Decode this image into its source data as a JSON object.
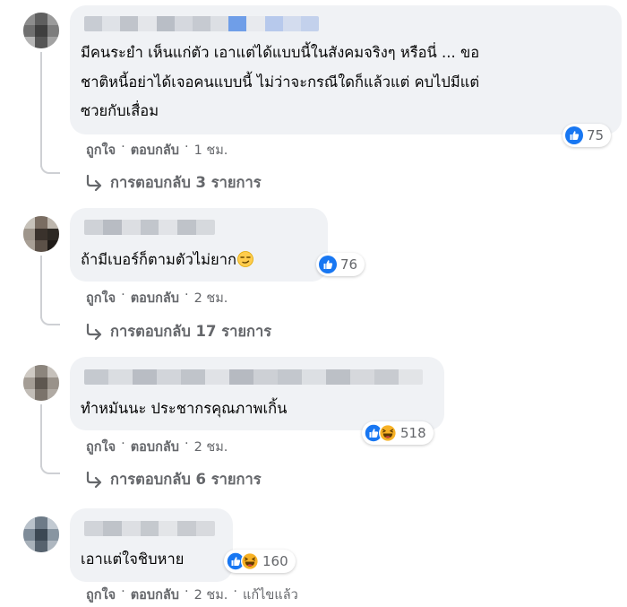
{
  "comments": [
    {
      "text_lines": [
        "มีคนระยำ เห็นแก่ตัว เอาแต่ได้แบบนี้ในสังคมจริงๆ หรือนี่ ... ขอ",
        "ชาติหนี้อย่าได้เจอคนแบบนี้ ไม่ว่าจะกรณีใดก็แล้วแต่ คบไปมีแต่",
        "ซวยกับเสื่อม"
      ],
      "reaction_icons": [
        "like-reaction-icon"
      ],
      "reaction_count": "75",
      "like_label": "ถูกใจ",
      "reply_label": "ตอบกลับ",
      "time": "1 ชม.",
      "replies_label": "การตอบกลับ 3 รายการ"
    },
    {
      "text_lines": [
        "ถ้ามีเบอร์ก็ตามตัวไม่ยาก"
      ],
      "emoji": "smirk-emoji",
      "reaction_icons": [
        "like-reaction-icon"
      ],
      "reaction_count": "76",
      "like_label": "ถูกใจ",
      "reply_label": "ตอบกลับ",
      "time": "2 ชม.",
      "replies_label": "การตอบกลับ 17 รายการ"
    },
    {
      "text_lines": [
        "ทำหมันนะ ประชากรคุณภาพเกิ้น"
      ],
      "reaction_icons": [
        "like-reaction-icon",
        "haha-reaction-icon"
      ],
      "reaction_count": "518",
      "like_label": "ถูกใจ",
      "reply_label": "ตอบกลับ",
      "time": "2 ชม.",
      "replies_label": "การตอบกลับ 6 รายการ"
    },
    {
      "text_lines": [
        "เอาแต่ใจชิบหาย"
      ],
      "reaction_icons": [
        "like-reaction-icon",
        "haha-reaction-icon"
      ],
      "reaction_count": "160",
      "like_label": "ถูกใจ",
      "reply_label": "ตอบกลับ",
      "time": "2 ชม.",
      "edited_label": "แก้ไขแล้ว"
    }
  ],
  "separator": "·",
  "colors": {
    "bubble": "#f0f2f5",
    "meta": "#65676b",
    "like_blue": "#1877f2",
    "haha_yellow": "#f7b125",
    "thread_line": "#ced0d4"
  }
}
